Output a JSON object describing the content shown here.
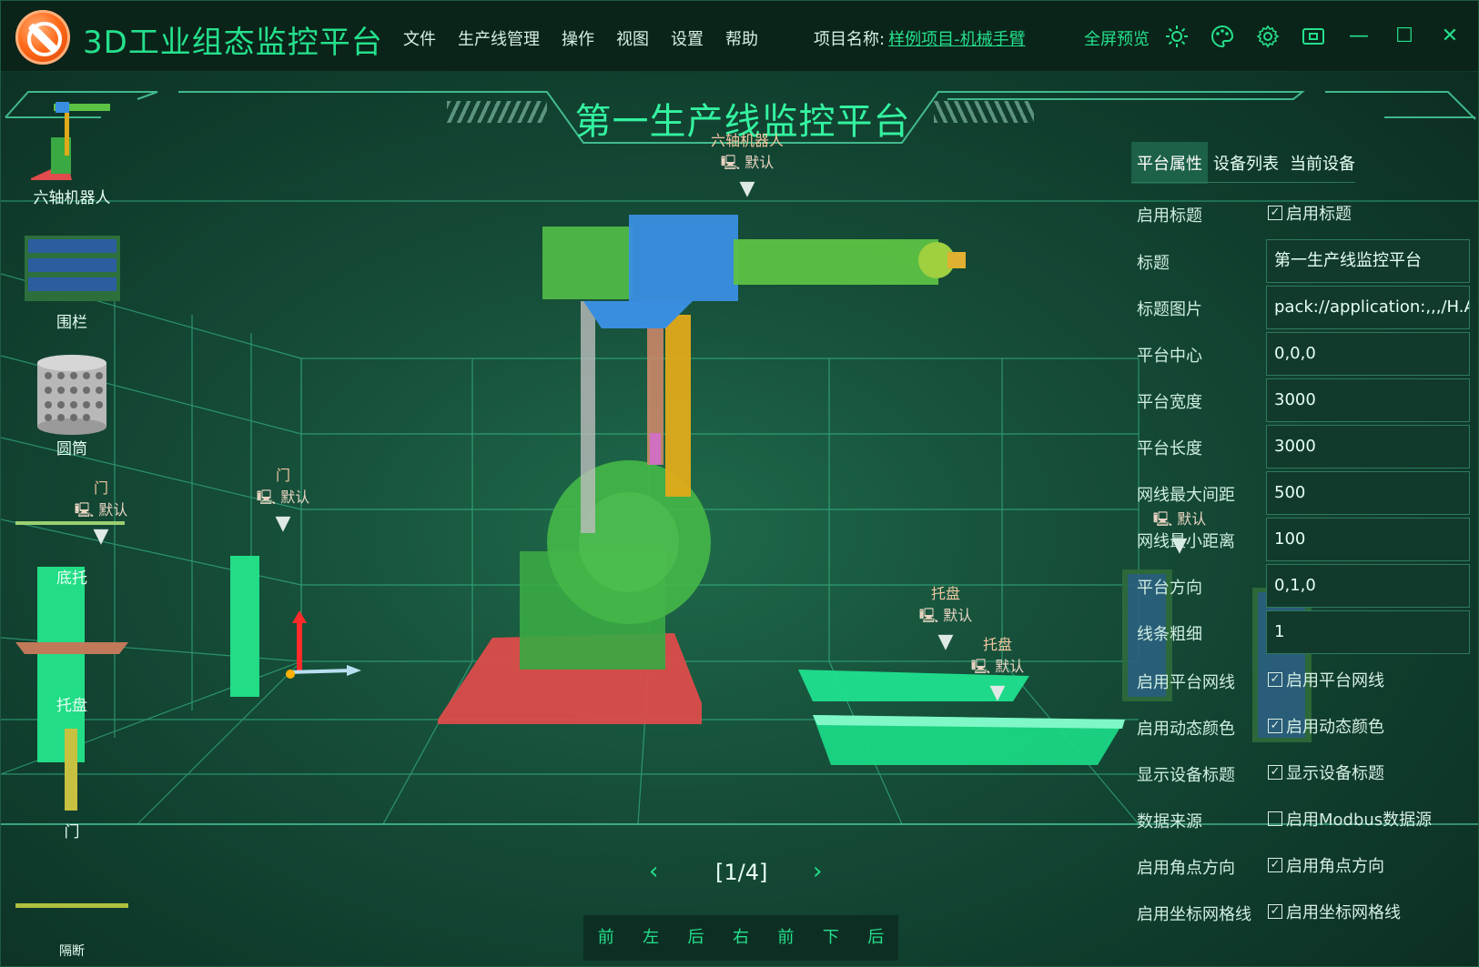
{
  "app": {
    "title": "3D工业组态监控平台"
  },
  "menu": [
    "文件",
    "生产线管理",
    "操作",
    "视图",
    "设置",
    "帮助"
  ],
  "project": {
    "label": "项目名称:",
    "name": "样例项目-机械手臂"
  },
  "toolbar": {
    "fullscreen": "全屏预览",
    "icons": [
      "sun-icon",
      "palette-icon",
      "gear-icon",
      "screen-icon"
    ]
  },
  "window": {
    "minimize": "—",
    "maximize": "☐",
    "close": "✕"
  },
  "scene": {
    "title": "第一生产线监控平台",
    "tags": {
      "robot": {
        "name": "六轴机器人",
        "state": "默认"
      },
      "door_left": {
        "name": "门",
        "state": "默认"
      },
      "door_mid": {
        "name": "门",
        "state": "默认"
      },
      "tray1": {
        "name": "托盘",
        "state": "默认"
      },
      "tray2": {
        "name": "托盘",
        "state": "默认"
      },
      "fence_right": {
        "state": "默认"
      }
    }
  },
  "palette": [
    {
      "label": "六轴机器人"
    },
    {
      "label": "围栏"
    },
    {
      "label": "圆筒"
    },
    {
      "label": "底托"
    },
    {
      "label": "托盘"
    },
    {
      "label": "门"
    },
    {
      "label": "隔断"
    }
  ],
  "panel": {
    "tabs": [
      "平台属性",
      "设备列表",
      "当前设备"
    ],
    "active_tab": "平台属性",
    "props": [
      {
        "label": "启用标题",
        "type": "check",
        "checked": true,
        "text": "启用标题"
      },
      {
        "label": "标题",
        "type": "input",
        "value": "第一生产线监控平台"
      },
      {
        "label": "标题图片",
        "type": "input",
        "value": "pack://application:,,,/H.A"
      },
      {
        "label": "平台中心",
        "type": "input",
        "value": "0,0,0"
      },
      {
        "label": "平台宽度",
        "type": "input",
        "value": "3000"
      },
      {
        "label": "平台长度",
        "type": "input",
        "value": "3000"
      },
      {
        "label": "网线最大间距",
        "type": "input",
        "value": "500"
      },
      {
        "label": "网线最小距离",
        "type": "input",
        "value": "100"
      },
      {
        "label": "平台方向",
        "type": "input",
        "value": "0,1,0"
      },
      {
        "label": "线条粗细",
        "type": "input",
        "value": "1"
      },
      {
        "label": "启用平台网线",
        "type": "check",
        "checked": true,
        "text": "启用平台网线"
      },
      {
        "label": "启用动态颜色",
        "type": "check",
        "checked": true,
        "text": "启用动态颜色"
      },
      {
        "label": "显示设备标题",
        "type": "check",
        "checked": true,
        "text": "显示设备标题"
      },
      {
        "label": "数据来源",
        "type": "check",
        "checked": false,
        "text": "启用Modbus数据源"
      },
      {
        "label": "启用角点方向",
        "type": "check",
        "checked": true,
        "text": "启用角点方向"
      },
      {
        "label": "启用坐标网格线",
        "type": "check",
        "checked": true,
        "text": "启用坐标网格线"
      }
    ]
  },
  "pager": {
    "prev": "‹",
    "page": "[1/4]",
    "next": "›"
  },
  "views": [
    "前",
    "左",
    "后",
    "右",
    "前",
    "下",
    "后"
  ],
  "colors": {
    "accent": "#25e08c",
    "panel_bg": "#113a2c",
    "grid": "#3fd19a"
  }
}
